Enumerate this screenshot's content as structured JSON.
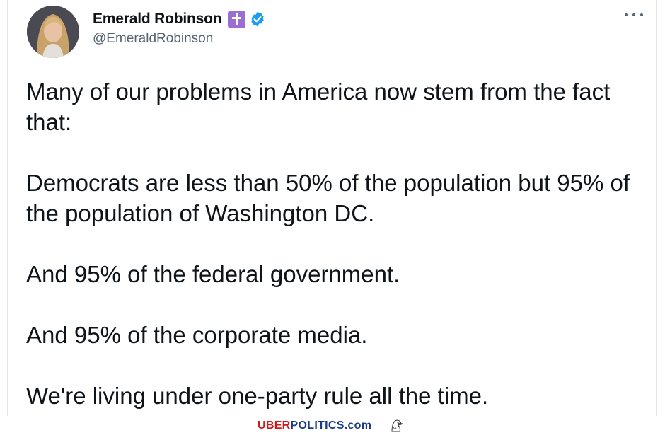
{
  "author": {
    "display_name": "Emerald Robinson",
    "handle": "@EmeraldRobinson",
    "badges": [
      "cross-icon",
      "verified-icon"
    ]
  },
  "tweet": {
    "paragraphs": [
      "Many of our problems in America now stem from the fact that:",
      "Democrats are less than 50% of the population but 95% of the population of Washington DC.",
      "And 95% of the federal government.",
      "And 95% of the corporate media.",
      "We're living under one-party rule all the time."
    ]
  },
  "watermark": {
    "part1": "UBER",
    "part2": "POLITICS",
    "part3": ".com"
  },
  "colors": {
    "verified": "#1d9bf0",
    "cross_badge": "#9b6fd1",
    "text": "#0f1419",
    "secondary": "#536471",
    "watermark_red": "#d01919",
    "watermark_blue": "#1c3a8c"
  }
}
